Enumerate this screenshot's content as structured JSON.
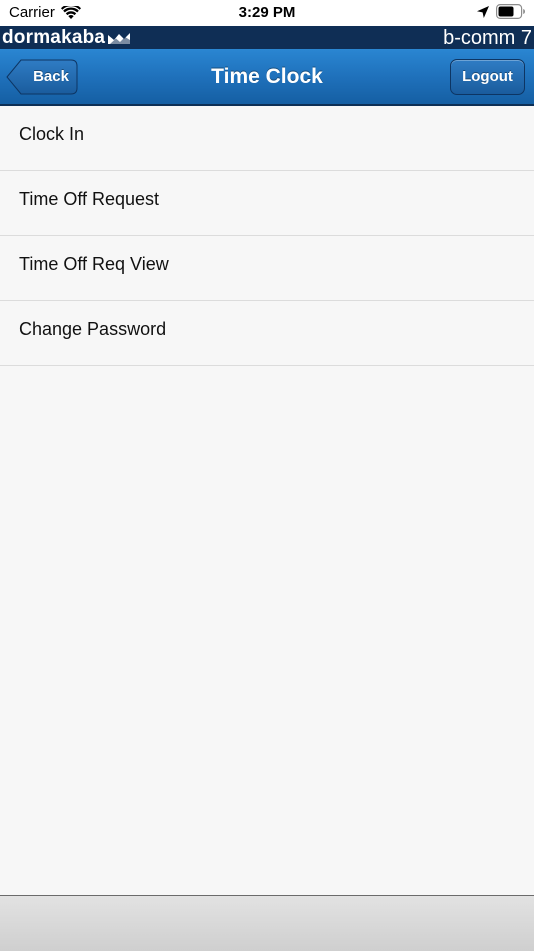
{
  "status_bar": {
    "carrier": "Carrier",
    "time": "3:29 PM"
  },
  "brand": {
    "logo_text": "dormakaba",
    "product": "b-comm 7"
  },
  "nav": {
    "title": "Time Clock",
    "back_label": "Back",
    "logout_label": "Logout"
  },
  "menu": {
    "items": [
      {
        "label": "Clock In"
      },
      {
        "label": "Time Off Request"
      },
      {
        "label": "Time Off Req View"
      },
      {
        "label": "Change Password"
      }
    ]
  },
  "colors": {
    "brand_bar": "#0f2e55",
    "nav_bar": "#1e6fb9",
    "background": "#f7f7f7"
  }
}
